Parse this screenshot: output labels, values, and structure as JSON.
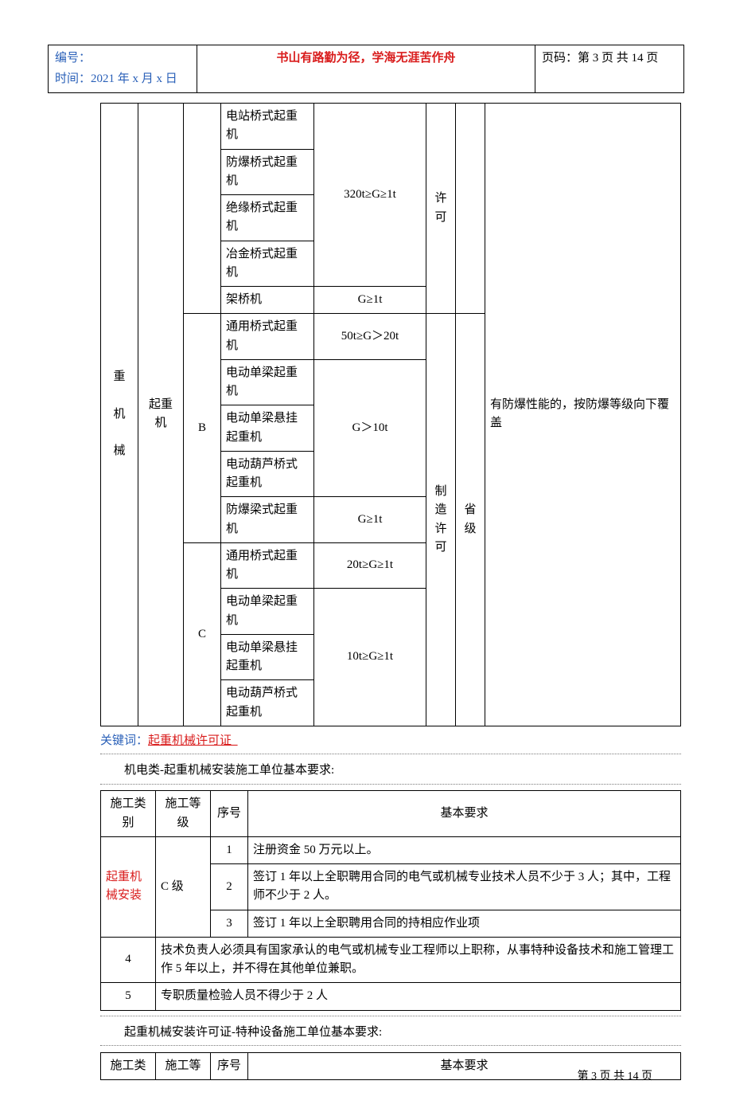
{
  "header": {
    "serial_label": "编号：",
    "time_label": "时间：2021 年 x 月 x 日",
    "motto": "书山有路勤为径，学海无涯苦作舟",
    "page_label": "页码：第 3 页  共 14 页"
  },
  "main_table": {
    "col1_a": "重",
    "col1_b": "机",
    "col1_c": "械",
    "col2": "起重机",
    "col8_desc": "有防爆性能的，按防爆等级向下覆盖",
    "r1c4": "电站桥式起重机",
    "r2c4": "防爆桥式起重机",
    "r3c4": "绝缘桥式起重机",
    "r4c4": "冶金桥式起重机",
    "r5c4": "架桥机",
    "r1_5c5": "320t≥G≥1t",
    "r5c5": "G≥1t",
    "r1_5c6a": "许",
    "r1_5c6b": "可",
    "grpB": "B",
    "r6c4": "通用桥式起重机",
    "r6c5": "50t≥G＞20t",
    "r7c4": "电动单梁起重机",
    "r8c4": "电动单梁悬挂起重机",
    "r9c4": "电动葫芦桥式起重机",
    "r7_9c5": "G＞10t",
    "r10c4": "防爆梁式起重机",
    "r10c5": "G≥1t",
    "c6_mfg_a": "制",
    "c6_mfg_b": "造",
    "c6_mfg_c": "许",
    "c6_mfg_d": "可",
    "c7_prov_a": "省",
    "c7_prov_b": "级",
    "grpC": "C",
    "r11c4": "通用桥式起重机",
    "r11c5": "20t≥G≥1t",
    "r12c4": "电动单梁起重机",
    "r13c4": "电动单梁悬挂起重机",
    "r14c4": "电动葫芦桥式起重机",
    "r12_14c5": "10t≥G≥1t"
  },
  "keywords": {
    "label": "关键词：",
    "text": "起重机械许可证_"
  },
  "section1_title": "机电类-起重机械安装施工单位基本要求:",
  "req_table1": {
    "h1": "施工类别",
    "h2": "施工等级",
    "h3": "序号",
    "h4": "基本要求",
    "cat": "起重机械安装",
    "grade": "C 级",
    "r1_no": "1",
    "r1_txt": "注册资金 50 万元以上。",
    "r2_no": "2",
    "r2_txt": "签订 1 年以上全职聘用合同的电气或机械专业技术人员不少于 3 人；其中，工程师不少于 2 人。",
    "r3_no": "3",
    "r3_txt": "签订 1 年以上全职聘用合同的持相应作业项",
    "r4_no": "4",
    "r4_txt": "技术负责人必须具有国家承认的电气或机械专业工程师以上职称，从事特种设备技术和施工管理工作 5 年以上，并不得在其他单位兼职。",
    "r5_no": "5",
    "r5_txt": "专职质量检验人员不得少于 2 人"
  },
  "section2_title": "起重机械安装许可证-特种设备施工单位基本要求:",
  "req_table2": {
    "h1": "施工类",
    "h2": "施工等",
    "h3": "序号",
    "h4": "基本要求"
  },
  "footer": "第 3 页 共 14 页"
}
